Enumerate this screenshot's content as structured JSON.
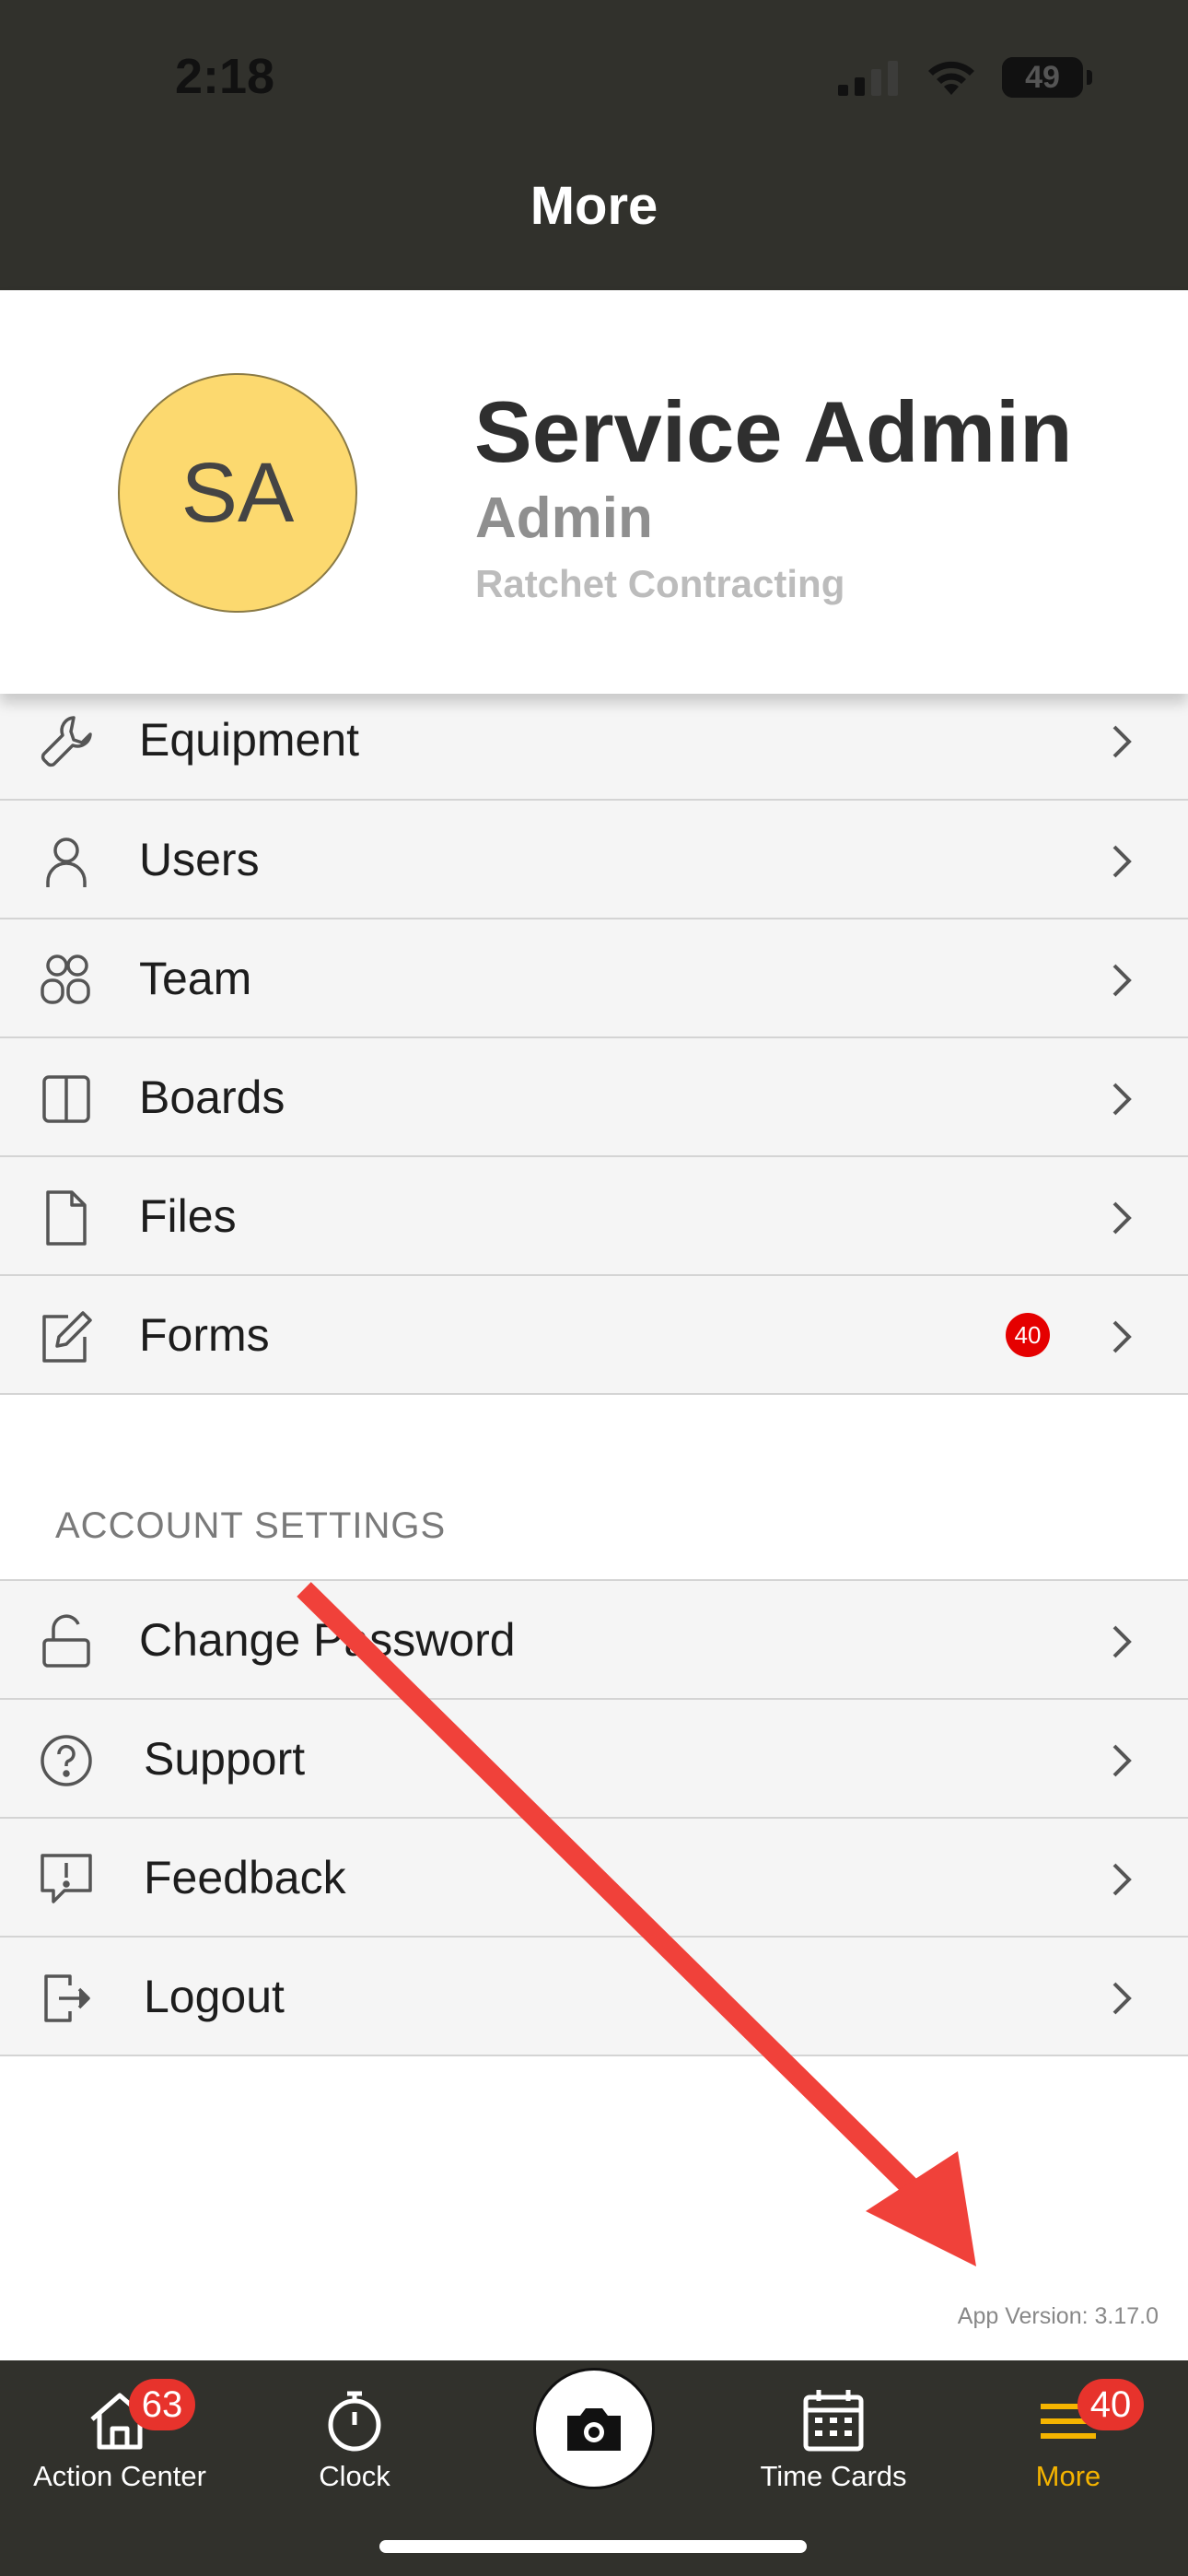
{
  "status_bar": {
    "time": "2:18",
    "battery": "49"
  },
  "header": {
    "title": "More"
  },
  "profile": {
    "initials": "SA",
    "name": "Service Admin",
    "role": "Admin",
    "company": "Ratchet Contracting",
    "avatar_color": "#fcd96f"
  },
  "menu": [
    {
      "label": "Equipment",
      "icon": "wrench-icon"
    },
    {
      "label": "Users",
      "icon": "user-icon"
    },
    {
      "label": "Team",
      "icon": "team-icon"
    },
    {
      "label": "Boards",
      "icon": "boards-icon"
    },
    {
      "label": "Files",
      "icon": "file-icon"
    },
    {
      "label": "Forms",
      "icon": "edit-form-icon",
      "badge": "40"
    }
  ],
  "account_settings": {
    "title": "ACCOUNT SETTINGS",
    "items": [
      {
        "label": "Change Password",
        "icon": "unlock-icon"
      },
      {
        "label": "Support",
        "icon": "help-icon"
      },
      {
        "label": "Feedback",
        "icon": "feedback-icon"
      },
      {
        "label": "Logout",
        "icon": "logout-icon"
      }
    ]
  },
  "app_version": "App Version: 3.17.0",
  "tabbar": {
    "action_center": {
      "label": "Action Center",
      "badge": "63"
    },
    "clock": {
      "label": "Clock"
    },
    "time_cards": {
      "label": "Time Cards"
    },
    "more": {
      "label": "More",
      "badge": "40"
    },
    "active_color": "#f5b400"
  }
}
